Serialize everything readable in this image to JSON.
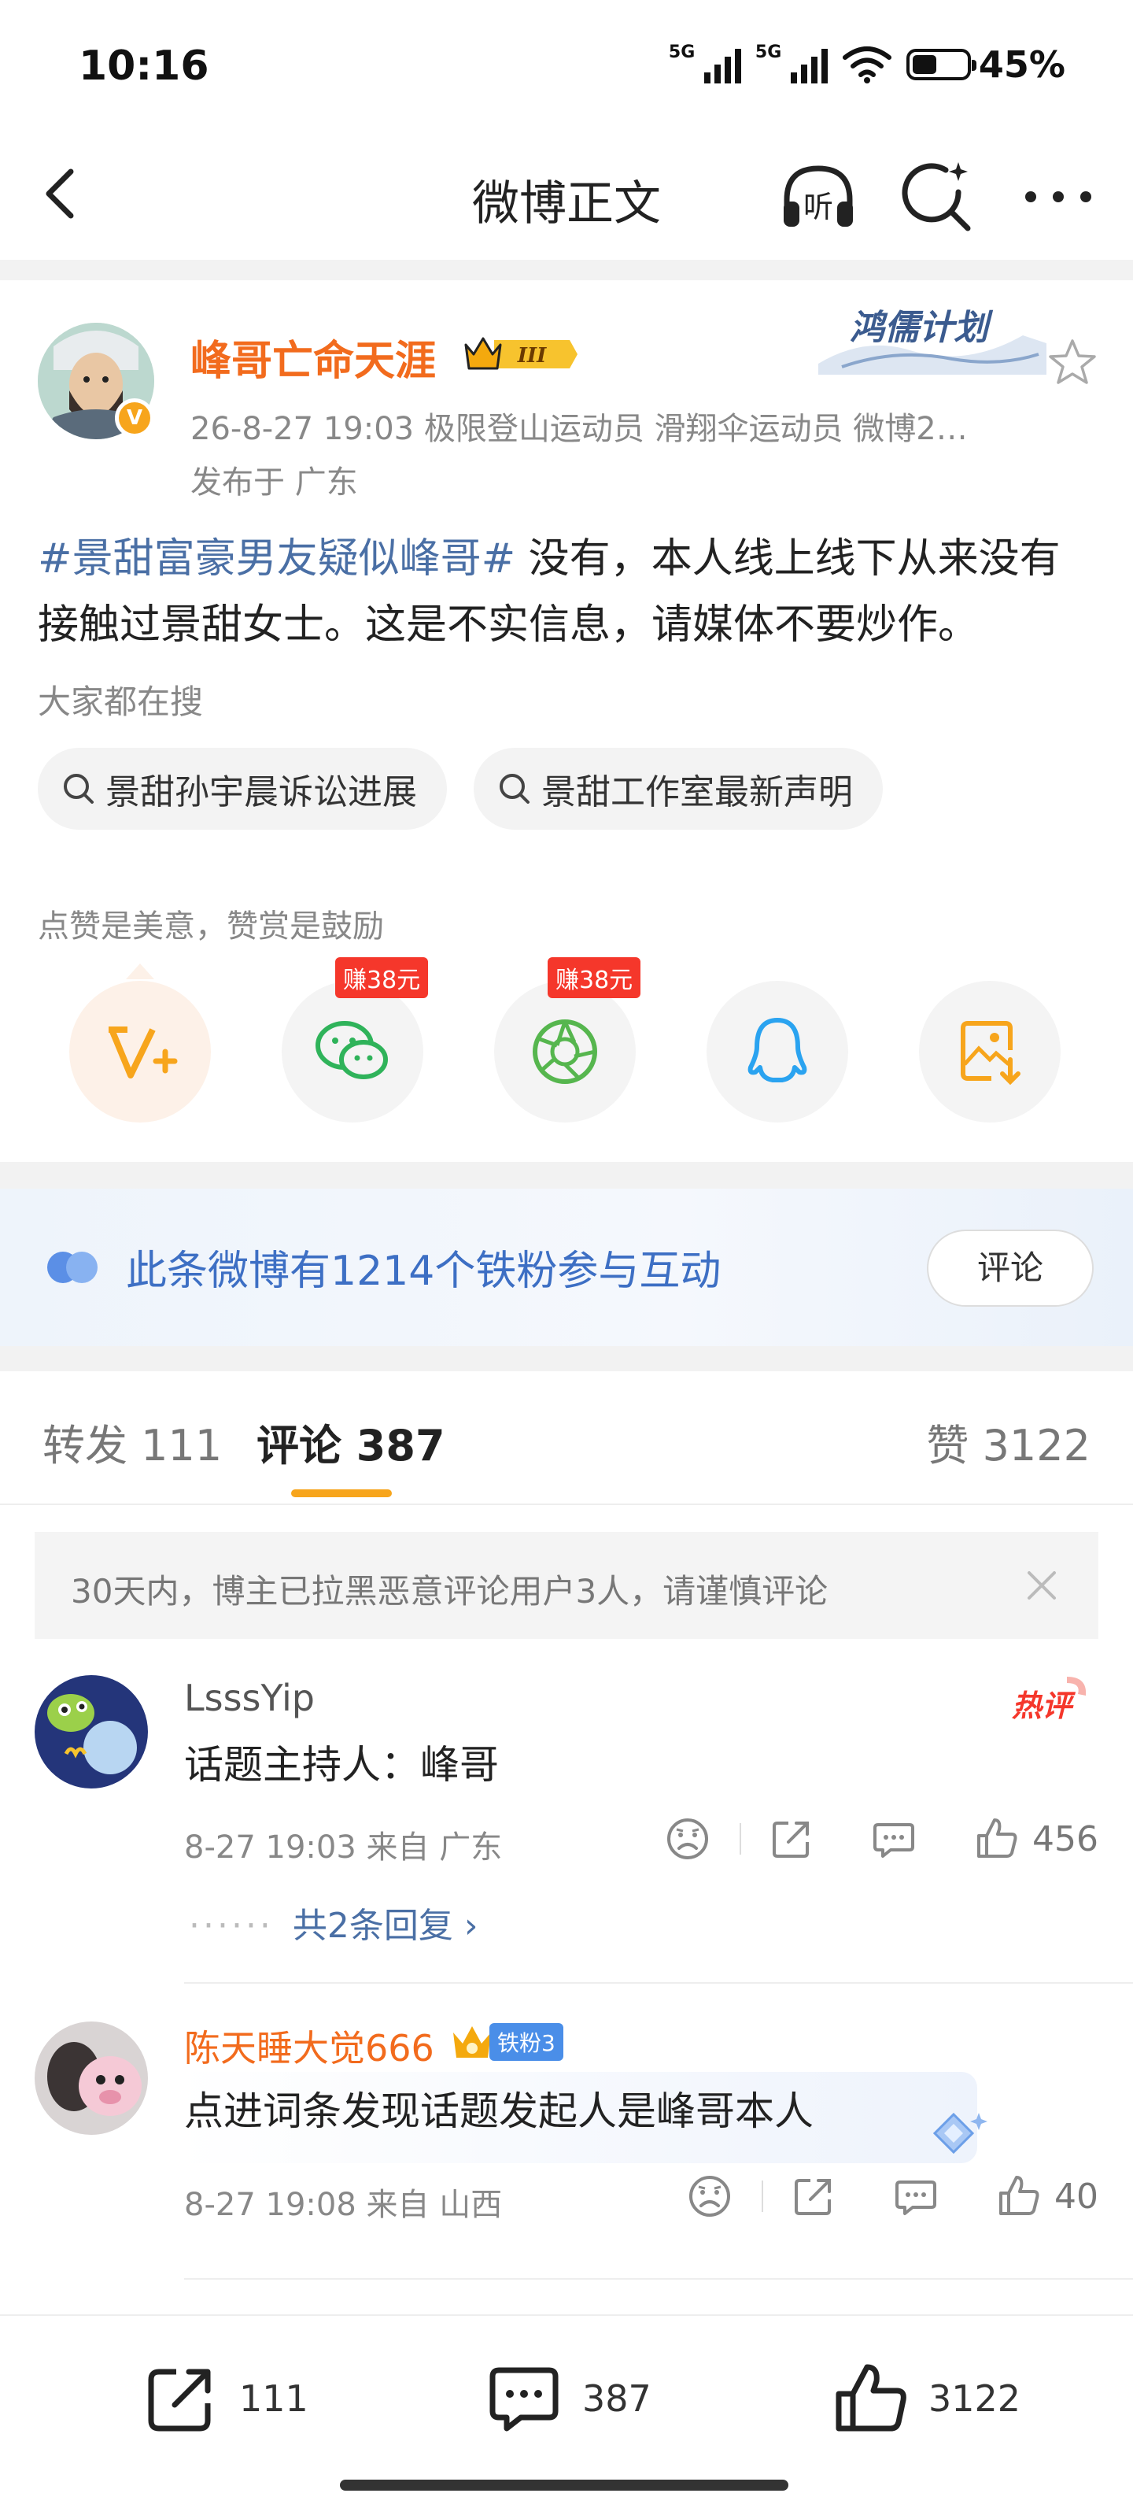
{
  "status": {
    "time": "10:16",
    "net1": "5G",
    "net2": "5G",
    "battery": "45%",
    "battery_level": 0.45
  },
  "nav": {
    "title": "微博正文",
    "listen": "听"
  },
  "post": {
    "author": "峰哥亡命天涯",
    "member_level": "III",
    "campaign_label": "鸿儒计划",
    "meta": "26-8-27 19:03  极限登山运动员 滑翔伞运动员 微博2…",
    "location": "发布于 广东",
    "topic": "#景甜富豪男友疑似峰哥#",
    "body": " 没有，本人线上线下从来没有接触过景甜女士。这是不实信息，请媒体不要炒作。",
    "hot_search_label": "大家都在搜",
    "hot_searches": [
      "景甜孙宇晨诉讼进展",
      "景甜工作室最新声明"
    ],
    "reward_label": "点赞是美意，赞赏是鼓励",
    "earn_tag": "赚38元",
    "verified_mark": "V"
  },
  "fans_banner": {
    "text": "此条微博有1214个铁粉参与互动",
    "button": "评论"
  },
  "tabs": {
    "repost": "转发 111",
    "comment": "评论 387",
    "like": "赞 3122"
  },
  "notice": {
    "text": "30天内，博主已拉黑恶意评论用户3人，请谨慎评论"
  },
  "comments": [
    {
      "name": "LsssYip",
      "text": "话题主持人：峰哥",
      "meta": "8-27 19:03  来自 广东",
      "likes": "456",
      "badge": "热评",
      "replies": "共2条回复 ›",
      "replies_dots": "······"
    },
    {
      "name": "陈天睡大觉666",
      "fan_level": "铁粉3",
      "text": "点进词条发现话题发起人是峰哥本人",
      "meta": "8-27 19:08  来自 山西",
      "likes": "40"
    }
  ],
  "bottom": {
    "repost": "111",
    "comment": "387",
    "like": "3122"
  },
  "colors": {
    "accent_orange": "#f26b1d",
    "topic_blue": "#4a6fa5",
    "tab_underline": "#f7a51c",
    "earn_red": "#f5372b"
  }
}
